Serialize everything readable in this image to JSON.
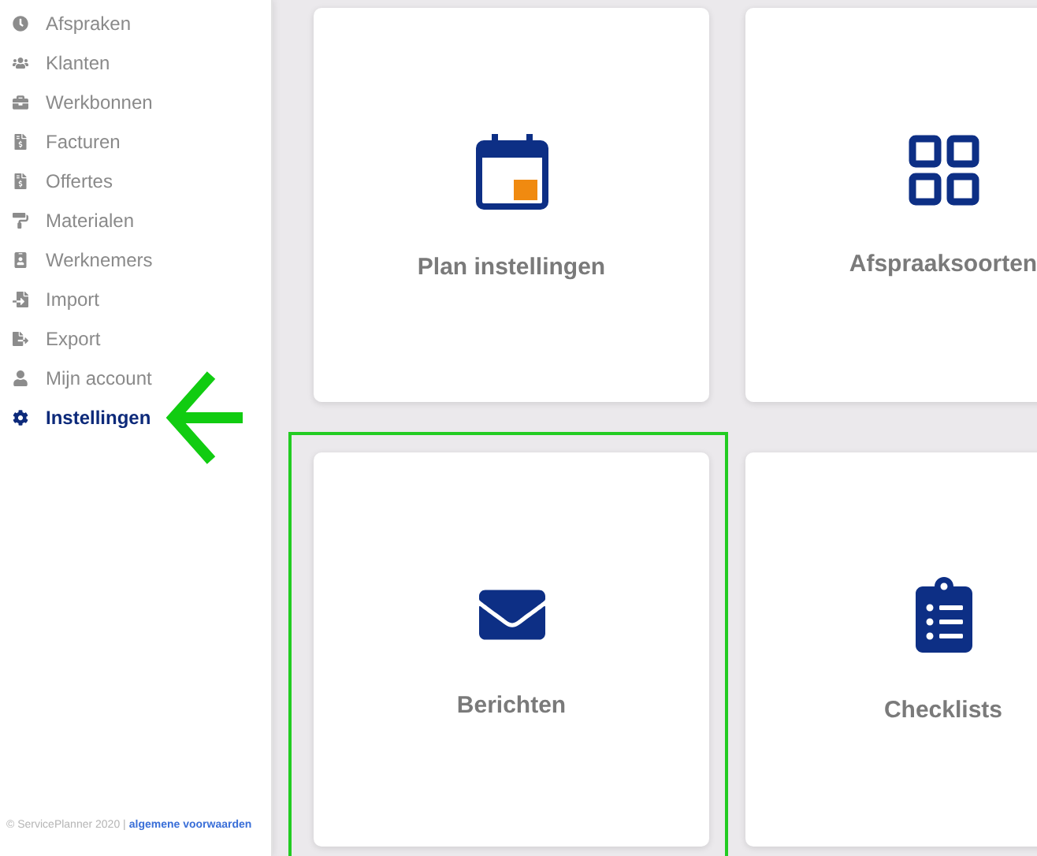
{
  "sidebar": {
    "items": [
      {
        "label": "Afspraken",
        "selected": false,
        "arrow": false
      },
      {
        "label": "Klanten",
        "selected": false,
        "arrow": false
      },
      {
        "label": "Werkbonnen",
        "selected": false,
        "arrow": false
      },
      {
        "label": "Facturen",
        "selected": false,
        "arrow": false
      },
      {
        "label": "Offertes",
        "selected": false,
        "arrow": false
      },
      {
        "label": "Materialen",
        "selected": false,
        "arrow": false
      },
      {
        "label": "Werknemers",
        "selected": false,
        "arrow": false
      },
      {
        "label": "Import",
        "selected": false,
        "arrow": false
      },
      {
        "label": "Export",
        "selected": false,
        "arrow": false
      },
      {
        "label": "Mijn account",
        "selected": false,
        "arrow": false
      },
      {
        "label": "Instellingen",
        "selected": true,
        "arrow": true
      }
    ],
    "footer": {
      "copyright": "© ServicePlanner 2020 |",
      "link": "algemene voorwaarden"
    }
  },
  "cards": [
    {
      "label": "Plan instellingen",
      "highlighted": false
    },
    {
      "label": "Afspraaksoorten",
      "highlighted": false
    },
    {
      "label": "Berichten",
      "highlighted": true
    },
    {
      "label": "Checklists",
      "highlighted": false
    }
  ]
}
